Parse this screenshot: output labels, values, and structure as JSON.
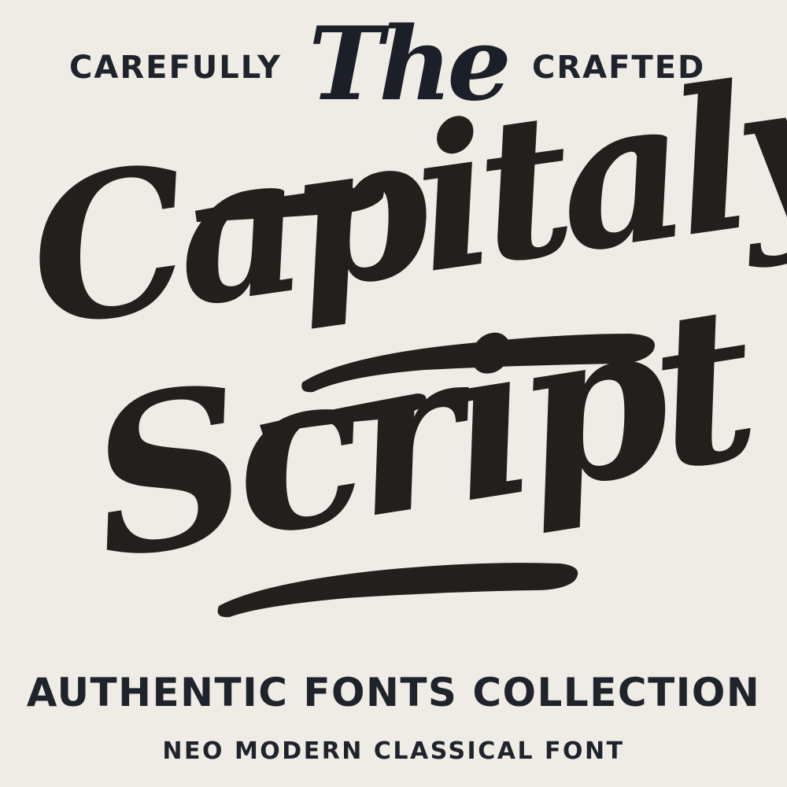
{
  "header": {
    "left_text": "CAREFULLY",
    "script_word": "The",
    "right_text": "CRAFTED"
  },
  "logo": {
    "line1": "Capitaly",
    "line2": "Script"
  },
  "footer": {
    "title": "AUTHENTIC FONTS COLLECTION",
    "subtitle": "NEO MODERN CLASSICAL FONT"
  },
  "colors": {
    "background": "#efebe5",
    "ink_dark": "#231f1c",
    "ink_navy": "#1f232b"
  }
}
